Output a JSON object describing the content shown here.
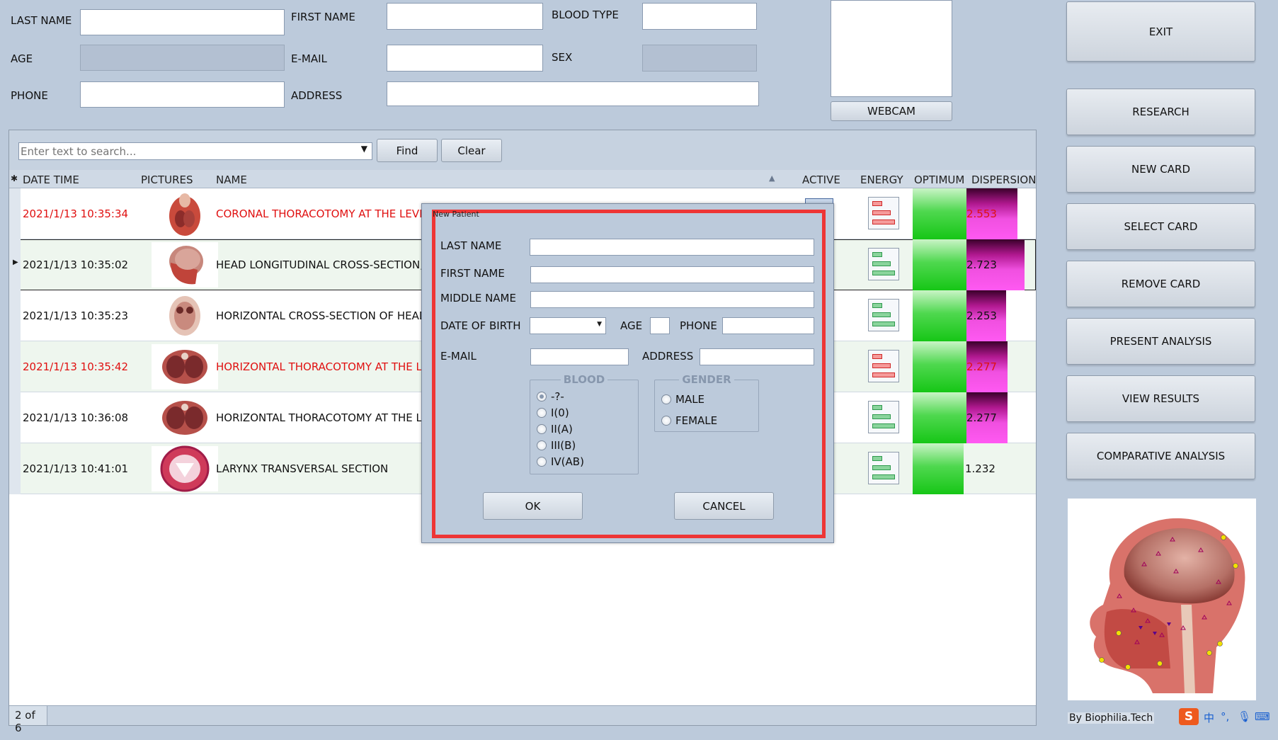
{
  "form": {
    "last_name_label": "LAST NAME",
    "first_name_label": "FIRST NAME",
    "blood_type_label": "BLOOD TYPE",
    "age_label": "AGE",
    "email_label": "E-MAIL",
    "sex_label": "SEX",
    "phone_label": "PHONE",
    "address_label": "ADDRESS",
    "webcam_button": "WEBCAM"
  },
  "sidebar": {
    "exit": "EXIT",
    "research": "RESEARCH",
    "new_card": "NEW CARD",
    "select_card": "SELECT CARD",
    "remove_card": "REMOVE CARD",
    "present_analysis": "PRESENT ANALYSIS",
    "view_results": "VIEW RESULTS",
    "comparative_analysis": "COMPARATIVE ANALYSIS",
    "credit": "By Biophilia.Tech"
  },
  "search": {
    "placeholder": "Enter text to search...",
    "find": "Find",
    "clear": "Clear"
  },
  "grid": {
    "columns": {
      "date_time": "DATE TIME",
      "pictures": "PICTURES",
      "name": "NAME",
      "active": "ACTIVE",
      "energy": "ENERGY",
      "optimum": "OPTIMUM",
      "dispersion": "DISPERSION"
    },
    "rows": [
      {
        "date": "2021/1/13 10:35:34",
        "name": "CORONAL THORACOTOMY AT THE LEVEL O",
        "value": "2.553",
        "red": true
      },
      {
        "date": "2021/1/13 10:35:02",
        "name": "HEAD LONGITUDINAL CROSS-SECTION, LEF",
        "value": "2.723",
        "red": false
      },
      {
        "date": "2021/1/13 10:35:23",
        "name": "HORIZONTAL CROSS-SECTION OF HEAD AT",
        "value": "2.253",
        "red": false
      },
      {
        "date": "2021/1/13 10:35:42",
        "name": "HORIZONTAL THORACOTOMY AT THE LEV",
        "value": "2.277",
        "red": true
      },
      {
        "date": "2021/1/13 10:36:08",
        "name": "HORIZONTAL THORACOTOMY AT THE LEV",
        "value": "2.277",
        "red": false
      },
      {
        "date": "2021/1/13 10:41:01",
        "name": "LARYNX TRANSVERSAL SECTION",
        "value": "1.232",
        "red": false
      }
    ],
    "pager": "2 of 6"
  },
  "modal": {
    "title": "New Patient",
    "last_name": "LAST NAME",
    "first_name": "FIRST NAME",
    "middle_name": "MIDDLE NAME",
    "dob": "DATE OF BIRTH",
    "age": "AGE",
    "phone": "PHONE",
    "email": "E-MAIL",
    "address": "ADDRESS",
    "blood_group": "BLOOD",
    "blood_options": [
      "-?-",
      "I(0)",
      "II(A)",
      "III(B)",
      "IV(AB)"
    ],
    "gender_group": "GENDER",
    "gender_options": [
      "MALE",
      "FEMALE"
    ],
    "ok": "OK",
    "cancel": "CANCEL"
  },
  "tray": {
    "ime": "中"
  },
  "colors": {
    "background": "#bccadb",
    "highlight": "#ee3535",
    "red_text": "#e01010"
  }
}
